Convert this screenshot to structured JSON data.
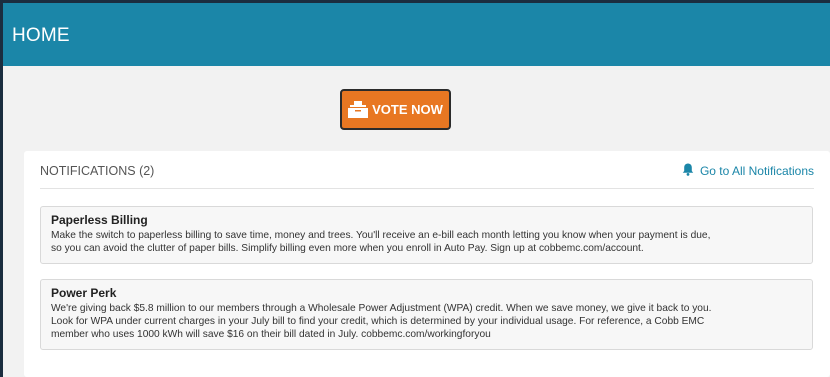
{
  "header": {
    "title": "HOME"
  },
  "vote": {
    "label": "VOTE NOW",
    "icon": "ballot-box-icon"
  },
  "notifications": {
    "heading": "NOTIFICATIONS (2)",
    "goto_label": "Go to All Notifications",
    "goto_icon": "bell-icon",
    "items": [
      {
        "title": "Paperless Billing",
        "body_lines": [
          "Make the switch to paperless billing to save time, money and trees. You'll receive an e-bill each month letting you know when your payment is due,",
          "so you can avoid the clutter of paper bills. Simplify billing even more when you enroll in Auto Pay. Sign up at cobbemc.com/account."
        ]
      },
      {
        "title": "Power Perk",
        "body_lines": [
          "We're giving back $5.8 million to our members through a Wholesale Power Adjustment (WPA) credit. When we save money, we give it back to you.",
          "Look for WPA under current charges in your July bill to find your credit, which is determined by your individual usage. For reference, a Cobb EMC",
          "member who uses 1000 kWh will save $16 on their bill dated in July. cobbemc.com/workingforyou"
        ]
      }
    ]
  },
  "colors": {
    "header_bg": "#1b86a8",
    "vote_bg": "#e87722",
    "link": "#1b86a8"
  }
}
